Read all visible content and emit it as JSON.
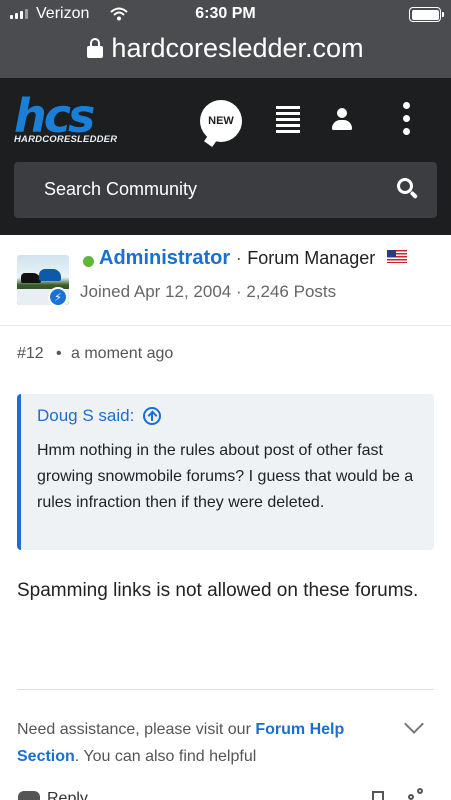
{
  "status_bar": {
    "carrier": "Verizon",
    "time": "6:30 PM"
  },
  "browser": {
    "url": "hardcoresledder.com"
  },
  "header": {
    "logo_mark": "hcs",
    "logo_sub": "HARDCORESLEDDER",
    "new_label": "NEW",
    "search_placeholder": "Search Community"
  },
  "post": {
    "author": {
      "name": "Administrator",
      "separator": "·",
      "title": "Forum Manager",
      "joined_info": "Joined Apr 12, 2004 · 2,246 Posts"
    },
    "number": "#12",
    "meta_dot": "•",
    "time_ago": "a moment ago",
    "quote": {
      "attribution": "Doug S said:",
      "text": "Hmm nothing in the rules about post of other fast growing snowmobile forums? I guess that would be a rules infraction then if they were deleted."
    },
    "body": "Spamming links is not allowed on these forums.",
    "signature": {
      "pre": "Need assistance, please visit our ",
      "link": "Forum Help Section",
      "post": ". You can also find helpful"
    },
    "actions": {
      "reply_label": "Reply"
    }
  },
  "colors": {
    "accent": "#1a6fd0",
    "header_bg": "#1c1e20",
    "online": "#5fb73a"
  }
}
